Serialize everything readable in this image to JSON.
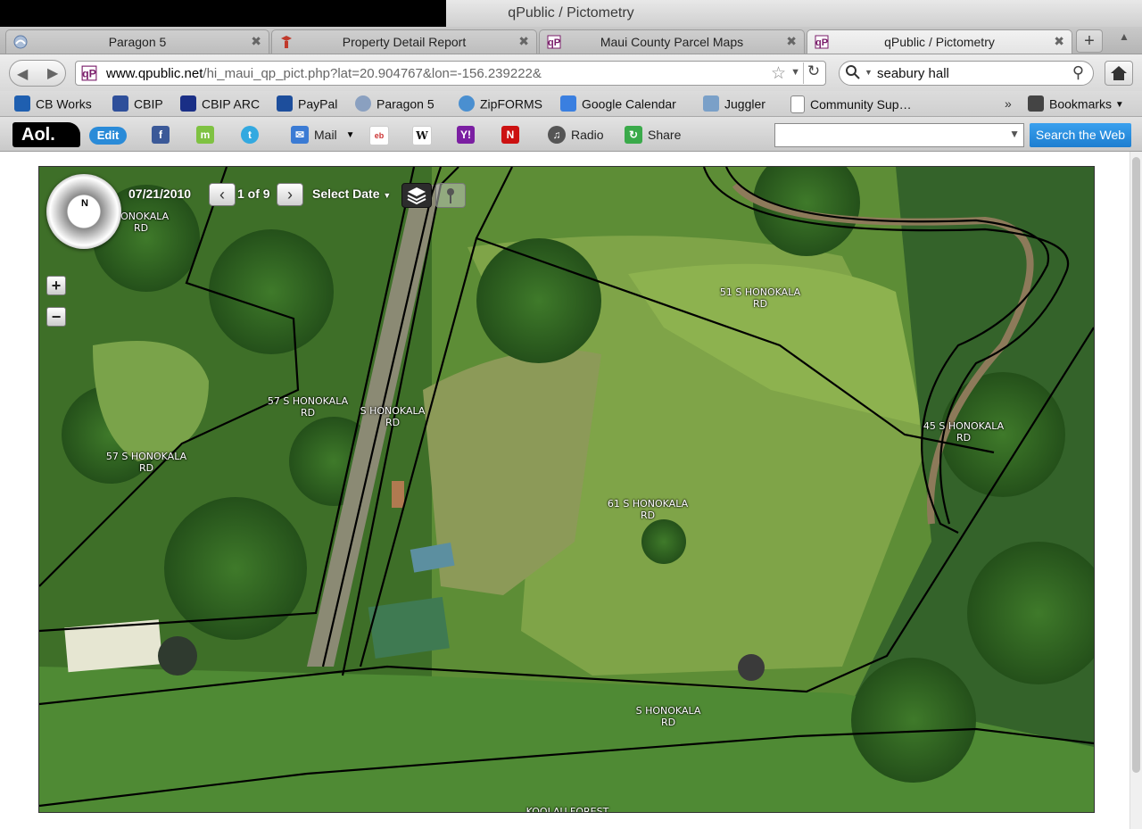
{
  "window": {
    "title": "qPublic / Pictometry"
  },
  "tabs": [
    {
      "label": "Paragon 5",
      "active": false
    },
    {
      "label": "Property Detail Report",
      "active": false
    },
    {
      "label": "Maui County Parcel Maps",
      "active": false
    },
    {
      "label": "qPublic / Pictometry",
      "active": true
    }
  ],
  "nav": {
    "url_domain": "www.qpublic.net",
    "url_rest": "/hi_maui_qp_pict.php?lat=20.904767&lon=-156.239222&",
    "search_text": "seabury hall"
  },
  "bookmarks": [
    {
      "label": "CB Works",
      "icon": "cb-works-icon",
      "color": "#1f5fb0"
    },
    {
      "label": "CBIP",
      "icon": "cbip-icon",
      "color": "#2e4f9a"
    },
    {
      "label": "CBIP ARC",
      "icon": "cbip-arc-icon",
      "color": "#1a2f86"
    },
    {
      "label": "PayPal",
      "icon": "paypal-icon",
      "color": "#1d4e9c"
    },
    {
      "label": "Paragon 5",
      "icon": "paragon-icon",
      "color": "#8aa0c0"
    },
    {
      "label": "ZipFORMS",
      "icon": "zipforms-icon",
      "color": "#4a8fd0"
    },
    {
      "label": "Google Calendar",
      "icon": "calendar-icon",
      "color": "#3a7fe0"
    },
    {
      "label": "Juggler",
      "icon": "juggler-icon",
      "color": "#7aa0c8"
    },
    {
      "label": "Community Sup…",
      "icon": "page-icon",
      "color": "#ffffff"
    },
    {
      "label": "Bookmarks",
      "icon": "bookmarks-icon",
      "color": "#444444"
    }
  ],
  "aol": {
    "logo": "Aol.",
    "edit": "Edit",
    "mail": "Mail",
    "radio": "Radio",
    "share": "Share",
    "search_button": "Search the Web"
  },
  "map": {
    "date": "07/21/2010",
    "page_count": "1 of 9",
    "select_date": "Select Date",
    "compass_letter": "N",
    "zoom_in": "+",
    "zoom_out": "−",
    "labels": [
      {
        "l1": "HONOKALA",
        "l2": "RD"
      },
      {
        "l1": "57 S HONOKALA",
        "l2": "RD"
      },
      {
        "l1": "S HONOKALA",
        "l2": "RD"
      },
      {
        "l1": "57 S HONOKALA",
        "l2": "RD"
      },
      {
        "l1": "51 S HONOKALA",
        "l2": "RD"
      },
      {
        "l1": "45 S HONOKALA",
        "l2": "RD"
      },
      {
        "l1": "61 S HONOKALA",
        "l2": "RD"
      },
      {
        "l1": "S HONOKALA",
        "l2": "RD"
      },
      {
        "l1": "KOOLAU FOREST",
        "l2": ""
      }
    ]
  }
}
